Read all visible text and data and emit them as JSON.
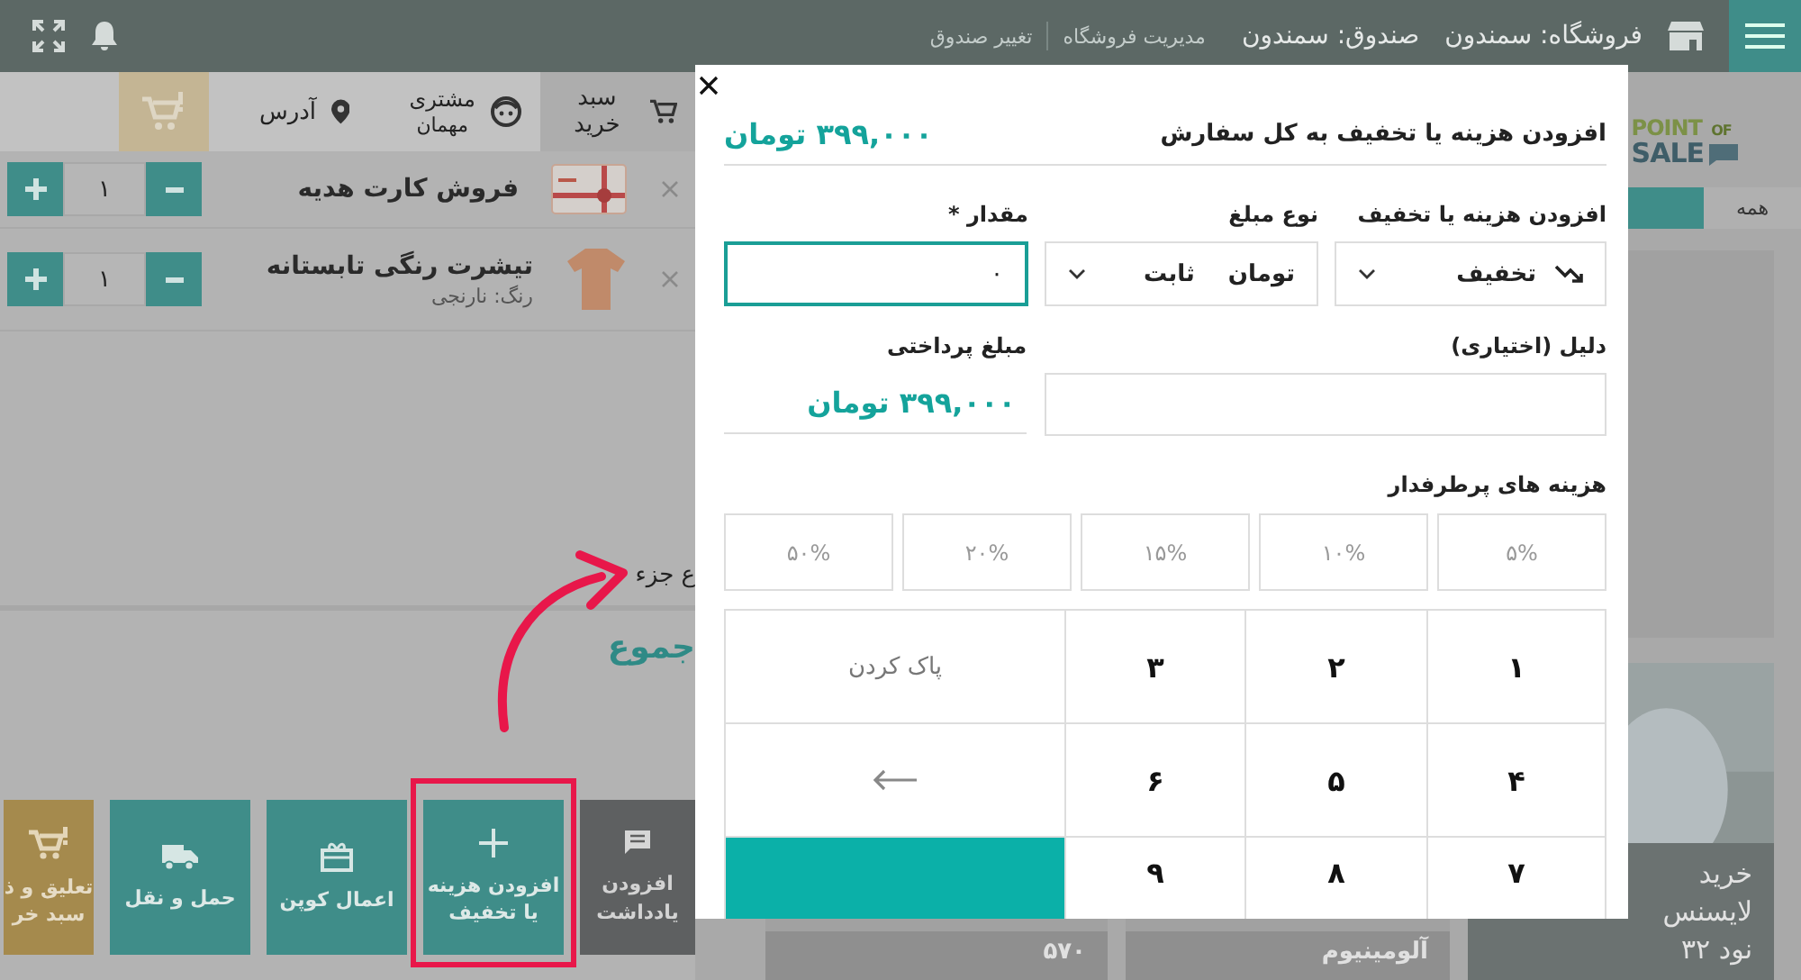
{
  "top_bar": {
    "store": "فروشگاه: سمندون",
    "register": "صندوق: سمندون",
    "links": [
      "مدیریت فروشگاه",
      "تغییر صندوق"
    ]
  },
  "cart": {
    "tabs": [
      {
        "kind": "cart",
        "label": "سبد خرید",
        "selected": true
      },
      {
        "kind": "customer",
        "label": "مشتری",
        "value": "مهمان",
        "selected": false
      },
      {
        "kind": "address",
        "label": "آدرس",
        "selected": false
      }
    ],
    "items": [
      {
        "kind": "gift-card",
        "name": "فروش کارت هدیه",
        "quantity": "۱"
      },
      {
        "kind": "tshirt",
        "name": "تیشرت رنگی تابستانه",
        "variant": "رنگ: نارنجی",
        "quantity": "۱"
      }
    ],
    "subtotal_label": "ع جزء",
    "total_label": "جموع",
    "actions": [
      {
        "kind": "note",
        "label": "افزودن\nیادداشت",
        "highlighted": false
      },
      {
        "kind": "fee",
        "label": "افزودن هزینه\nیا تخفیف",
        "highlighted": true
      },
      {
        "kind": "coupon",
        "label": "اعمال کوپن",
        "highlighted": false
      },
      {
        "kind": "shipping",
        "label": "حمل و نقل",
        "highlighted": false
      },
      {
        "kind": "hold",
        "label": "تعلیق و ذ\nسبد خر",
        "highlighted": false
      }
    ]
  },
  "catalog": {
    "logo": {
      "line1": "POINT",
      "line1_small": "OF",
      "line2": "SALE"
    },
    "tabs": [
      {
        "label": "همه",
        "selected": false
      },
      {
        "selected": true
      }
    ],
    "product": {
      "kind": "picture",
      "name": "خرید\nلایسنس\nنود ۳۲"
    },
    "bottom_labels": [
      "آلومینیوم",
      "۵۷۰"
    ]
  },
  "dialog": {
    "title": "افزودن هزینه یا تخفیف به کل سفارش",
    "total": "۳۹۹,۰۰۰ تومان",
    "fields": [
      {
        "kind": "select-with-icon",
        "label": "افزودن هزینه یا تخفیف",
        "value": "تخفیف"
      },
      {
        "kind": "select",
        "label": "نوع مبلغ",
        "value": "تومان ثابت"
      },
      {
        "kind": "input",
        "label": "مقدار *",
        "value": "۰",
        "focused": true
      }
    ],
    "reason_label": "دلیل (اختیاری)",
    "paid_label": "مبلغ پرداختی",
    "paid": "۳۹۹,۰۰۰ تومان",
    "presets_label": "هزینه های پرطرفدار",
    "presets": [
      "۵%",
      "۱۰%",
      "۱۵%",
      "۲۰%",
      "۵۰%"
    ],
    "keypad": [
      {
        "kind": "digit",
        "label": "۱"
      },
      {
        "kind": "digit",
        "label": "۲"
      },
      {
        "kind": "digit",
        "label": "۳"
      },
      {
        "kind": "clear",
        "label": "پاک کردن"
      },
      {
        "kind": "digit",
        "label": "۴"
      },
      {
        "kind": "digit",
        "label": "۵"
      },
      {
        "kind": "digit",
        "label": "۶"
      },
      {
        "kind": "backspace"
      },
      {
        "kind": "digit",
        "label": "۷"
      },
      {
        "kind": "digit",
        "label": "۸"
      },
      {
        "kind": "digit",
        "label": "۹"
      },
      {
        "kind": "submit"
      }
    ]
  }
}
